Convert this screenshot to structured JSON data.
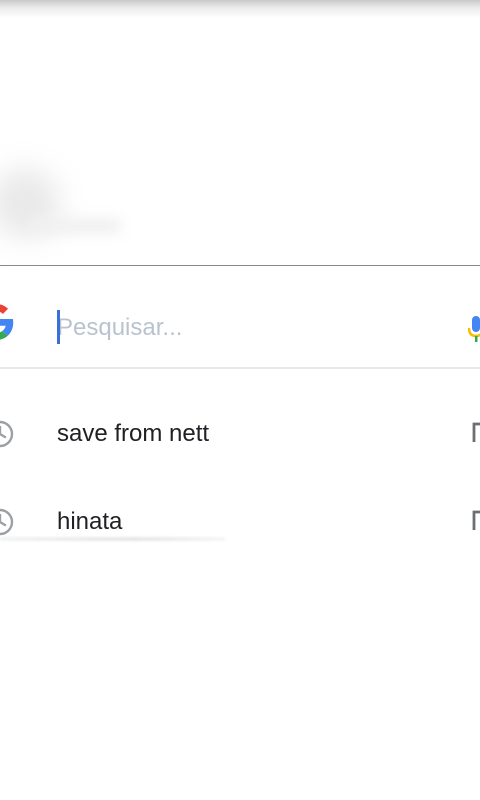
{
  "search": {
    "placeholder": "Pesquisar...",
    "value": ""
  },
  "icons": {
    "logo": "google-g-icon",
    "mic": "mic-icon",
    "history": "history-clock-icon",
    "fill": "arrow-fill-icon"
  },
  "colors": {
    "caret": "#3b6fd8",
    "placeholder": "#b9c3cf",
    "text": "#202124",
    "google_blue": "#4285F4",
    "google_red": "#EA4335",
    "google_yellow": "#FBBC05",
    "google_green": "#34A853"
  },
  "suggestions": [
    {
      "label": "save from nett"
    },
    {
      "label": "hinata"
    }
  ]
}
